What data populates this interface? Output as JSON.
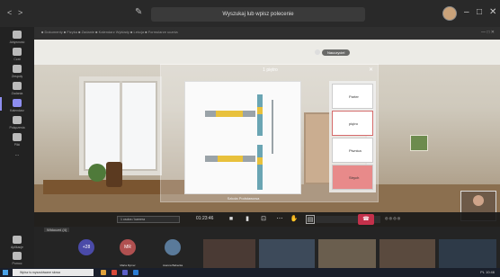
{
  "titlebar": {
    "back": "<",
    "forward": ">",
    "search_text": "Wyszukaj lub wpisz polecenie",
    "minimize": "–",
    "maximize": "□",
    "close": "✕"
  },
  "rail": {
    "items": [
      {
        "label": "Aktywność"
      },
      {
        "label": "Czat"
      },
      {
        "label": "Zespoły"
      },
      {
        "label": "Zadania"
      },
      {
        "label": "Kalendarz",
        "active": true
      },
      {
        "label": "Połączenia"
      },
      {
        "label": "Pliki"
      },
      {
        "label": "..."
      }
    ],
    "bottom": [
      {
        "label": "Aplikacje"
      },
      {
        "label": "Pomoc"
      }
    ]
  },
  "browserbar": {
    "tabs": "■ Dokumenty    ■ Fizyka    ■ Zadanie    ■ Kalendarz  Wykłady  ■ Lekcja    ■ Formularze ucznia",
    "controls": "— □ ✕"
  },
  "stage": {
    "name_pill": "Nauczyciel"
  },
  "panel": {
    "title": "1 piętro",
    "close": "✕",
    "caption": "Szkoła Podstawowa",
    "slides": [
      {
        "label": "Parter"
      },
      {
        "label": "piętro"
      },
      {
        "label": "Piwnica"
      },
      {
        "label": "Strych"
      }
    ]
  },
  "controls": {
    "field_text": "1 osoba / kamera",
    "timer": "01:23:46",
    "hangup": "☎",
    "tools": "◎ ◎ ◎ ◎"
  },
  "strip": {
    "label": "Widoczni (4)",
    "tiles": [
      {
        "initials": "+28",
        "name": "",
        "color": "#4a4aa8"
      },
      {
        "initials": "MR",
        "name": "Marta Rymer",
        "color": "#b05050"
      },
      {
        "initials": "",
        "name": "Joanna Babecka",
        "color": "#5a7a9a"
      }
    ]
  },
  "taskbar": {
    "search": "Wpisz tu wyszukiwane słowa",
    "tray": "PL  10:46"
  }
}
